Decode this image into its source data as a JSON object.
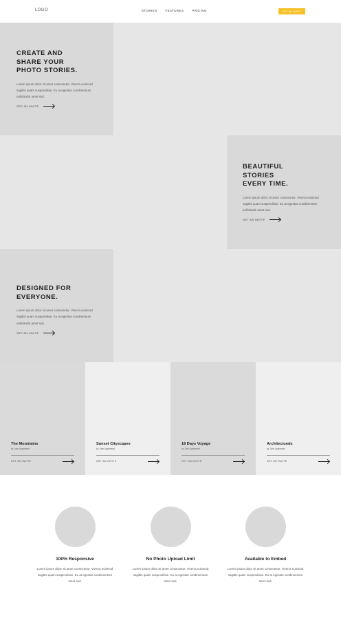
{
  "header": {
    "logo": "LOGO",
    "nav": [
      "STORIES",
      "FEATURES",
      "PRICING"
    ],
    "invite_label": "GET AN INVITE"
  },
  "hero": [
    {
      "title": "CREATE  AND\nSHARE YOUR\nPHOTO STORIES.",
      "body": "Lorem ipsum dolor sit amet consectetur. Viverra euismod sagittis quam suspendisse. Eu at egestas condimentum sollicitudin amet sed.",
      "cta": "GET AN INVITE"
    },
    {
      "title": "BEAUTIFUL\nSTORIES\nEVERY TIME.",
      "body": "Lorem ipsum dolor sit amet consectetur. Viverra euismod sagittis quam suspendisse. Eu at egestas condimentum sollicitudin amet sed.",
      "cta": "GET AN INVITE"
    },
    {
      "title": "DESIGNED FOR\nEVERYONE.",
      "body": "Lorem ipsum dolor sit amet consectetur. Viverra euismod sagittis quam suspendisse. Eu at egestas condimentum sollicitudin amet sed.",
      "cta": "GET AN INVITE"
    }
  ],
  "gallery": [
    {
      "title": "The Mountains",
      "author": "by John Appleseed",
      "cta": "GET AN INVITE",
      "bg": "#dadada"
    },
    {
      "title": "Sunset Cityscapes",
      "author": "by John Appleseed",
      "cta": "GET AN INVITE",
      "bg": "#efefef"
    },
    {
      "title": "18 Days Voyage",
      "author": "by John Appleseed",
      "cta": "GET AN INVITE",
      "bg": "#dadada"
    },
    {
      "title": "Architecturals",
      "author": "by John Appleseed",
      "cta": "GET AN INVITE",
      "bg": "#efefef"
    }
  ],
  "features": [
    {
      "title": "100% Responsive",
      "body": "Lorem ipsum dolor sit amet consectetur. Viverra euismod sagittis quam suspendisse. Eu at egestas condimentum amet sed."
    },
    {
      "title": "No Photo Upload Limit",
      "body": "Lorem ipsum dolor sit amet consectetur. Viverra euismod sagittis quam suspendisse. Eu at egestas condimentum amet sed."
    },
    {
      "title": "Available to Embed",
      "body": "Lorem ipsum dolor sit amet consectetur. Viverra euismod sagittis quam suspendisse. Eu at egestas condimentum amet sed."
    }
  ],
  "colors": {
    "accent": "#f5c126",
    "panel": "#d9d9d9",
    "band": "#e6e6e6"
  }
}
